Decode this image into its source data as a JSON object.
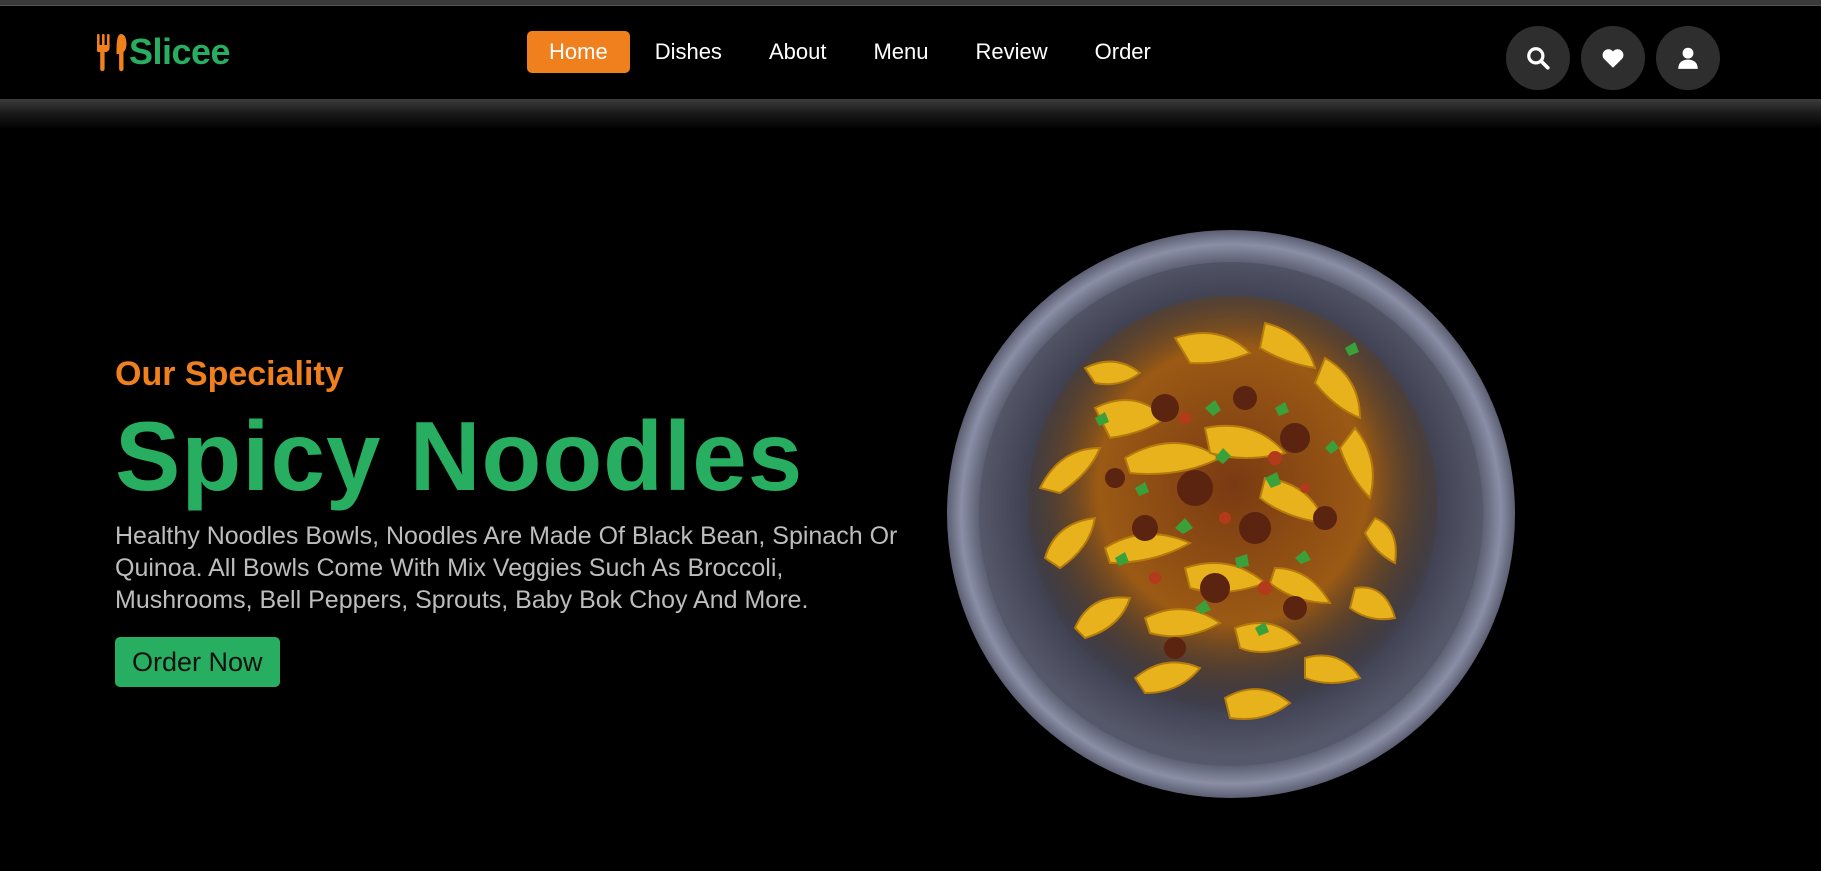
{
  "header": {
    "logo_text": "Slicee",
    "logo_icon": "fork-spoon-icon",
    "nav": [
      {
        "label": "Home",
        "active": true
      },
      {
        "label": "Dishes"
      },
      {
        "label": "About"
      },
      {
        "label": "Menu"
      },
      {
        "label": "Review"
      },
      {
        "label": "Order"
      }
    ],
    "icons": [
      "search-icon",
      "heart-icon",
      "user-icon"
    ]
  },
  "hero": {
    "subtitle": "Our Speciality",
    "title": "Spicy Noodles",
    "description": "Healthy Noodles Bowls, Noodles Are Made Of Black Bean, Spinach Or Quinoa. All Bowls Come With Mix Veggies Such As Broccoli, Mushrooms, Bell Peppers, Sprouts, Baby Bok Choy And More.",
    "cta_label": "Order Now"
  },
  "colors": {
    "brand_green": "#27ae60",
    "accent_orange": "#f0801e",
    "background": "#000000",
    "icon_button_bg": "#2e2e2e"
  }
}
